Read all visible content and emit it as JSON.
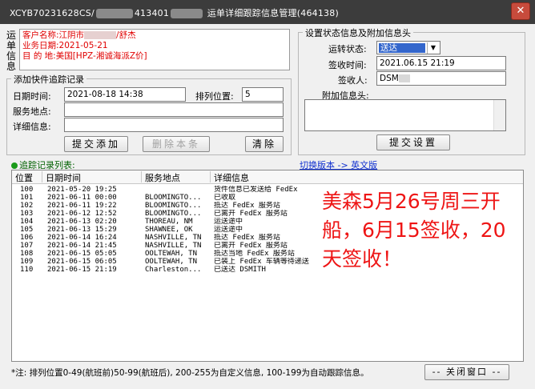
{
  "window": {
    "title_prefix": "XCYB70231628CS/",
    "title_mid": "413401",
    "title_suffix": " 运单详细跟踪信息管理(464138)",
    "close_glyph": "✕"
  },
  "waybill": {
    "vertical_label": "运单信息",
    "line1_prefix": "客户名称:江阴市",
    "line1_suffix": "/舒杰",
    "line2": "业务日期:2021-05-21",
    "line3": "目 的 地:美国[HPZ-湘诚海派Z价]"
  },
  "add_group": {
    "title": "添加快件追踪记录",
    "date_label": "日期时间:",
    "date_value": "2021-08-18 14:38",
    "pos_label": "排列位置:",
    "pos_value": "5",
    "place_label": "服务地点:",
    "place_value": "",
    "detail_label": "详细信息:",
    "detail_value": "",
    "submit_label": "提交添加",
    "delete_label": "删除本条",
    "clear_label": "清除"
  },
  "status_group": {
    "title": "设置状态信息及附加信息头",
    "status_label": "运转状态:",
    "status_value": "送达",
    "signtime_label": "签收时间:",
    "signtime_value": "2021.06.15 21:19",
    "signer_label": "签收人:",
    "signer_value": "DSM",
    "extra_label": "附加信息头:",
    "extra_value": "",
    "submit_label": "提交设置"
  },
  "list": {
    "title": "追踪记录列表:",
    "switch_link": "切换版本 -> 英文版",
    "columns": [
      "位置",
      "日期时间",
      "服务地点",
      "详细信息"
    ],
    "rows": [
      {
        "pos": "100",
        "time": "2021-05-20 19:25",
        "place": "",
        "detail": "货件信息已发送给 FedEx"
      },
      {
        "pos": "101",
        "time": "2021-06-11 00:00",
        "place": "BLOOMINGTO...",
        "detail": "已收取"
      },
      {
        "pos": "102",
        "time": "2021-06-11 19:22",
        "place": "BLOOMINGTO...",
        "detail": "抵达 FedEx 服务站"
      },
      {
        "pos": "103",
        "time": "2021-06-12 12:52",
        "place": "BLOOMINGTO...",
        "detail": "已离开 FedEx 服务站"
      },
      {
        "pos": "104",
        "time": "2021-06-13 02:20",
        "place": "THOREAU, NM",
        "detail": "运送途中"
      },
      {
        "pos": "105",
        "time": "2021-06-13 15:29",
        "place": "SHAWNEE, OK",
        "detail": "运送途中"
      },
      {
        "pos": "106",
        "time": "2021-06-14 16:24",
        "place": "NASHVILLE, TN",
        "detail": "抵达 FedEx 服务站"
      },
      {
        "pos": "107",
        "time": "2021-06-14 21:45",
        "place": "NASHVILLE, TN",
        "detail": "已离开 FedEx 服务站"
      },
      {
        "pos": "108",
        "time": "2021-06-15 05:05",
        "place": "OOLTEWAH, TN",
        "detail": "抵达当地 FedEx 服务站"
      },
      {
        "pos": "109",
        "time": "2021-06-15 06:05",
        "place": "OOLTEWAH, TN",
        "detail": "已装上 FedEx 车辆等待递送"
      },
      {
        "pos": "110",
        "time": "2021-06-15 21:19",
        "place": "Charleston...",
        "detail": "已送达 DSMITH"
      }
    ]
  },
  "overlay": {
    "text": "美森5月26号周三开船，6月15签收，20天签收！",
    "color": "#ee1515"
  },
  "footnote": "*注: 排列位置0-49(航班前)50-99(航班后), 200-255为自定义信息, 100-199为自动跟踪信息。",
  "close_window_label": "-- 关闭窗口 --"
}
